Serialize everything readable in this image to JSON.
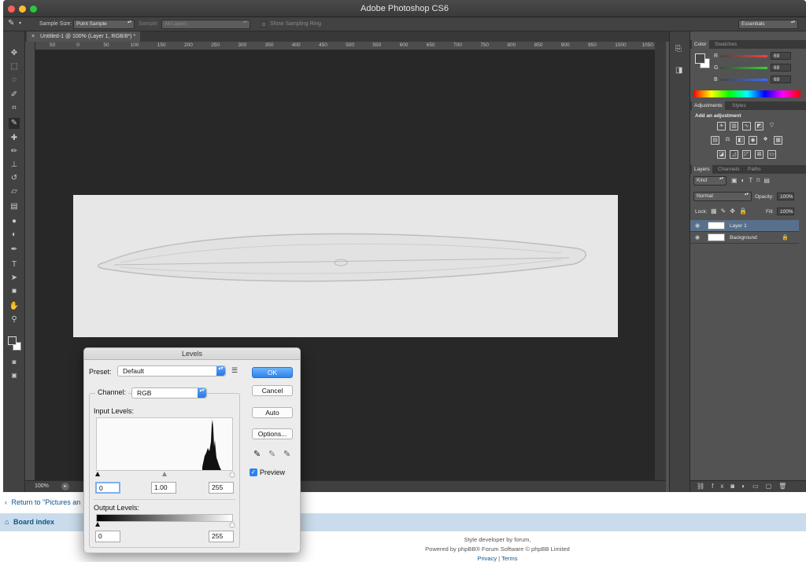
{
  "window": {
    "title": "Adobe Photoshop CS6"
  },
  "options_bar": {
    "sample_size_label": "Sample Size:",
    "sample_size_value": "Point Sample",
    "sample_label": "Sample:",
    "sample_value": "All Layers",
    "sampling_ring_label": "Show Sampling Ring",
    "workspace": "Essentials"
  },
  "document_tab": {
    "close": "×",
    "title": "Untitled-1 @ 100% (Layer 1, RGB/8*) *"
  },
  "ruler_ticks": [
    "50",
    "0",
    "50",
    "100",
    "150",
    "200",
    "250",
    "300",
    "350",
    "400",
    "450",
    "500",
    "550",
    "600",
    "650",
    "700",
    "750",
    "800",
    "850",
    "900",
    "950",
    "1000",
    "1050"
  ],
  "status": {
    "zoom": "100%"
  },
  "color_panel": {
    "tabs": [
      "Color",
      "Swatches"
    ],
    "channels": [
      {
        "label": "R",
        "value": "69",
        "gradient": "#ff3b3b"
      },
      {
        "label": "G",
        "value": "69",
        "gradient": "#37d237"
      },
      {
        "label": "B",
        "value": "69",
        "gradient": "#3a6bff"
      }
    ],
    "foreground": "#454545",
    "background": "#ffffff"
  },
  "adjustments_panel": {
    "tabs": [
      "Adjustments",
      "Styles"
    ],
    "heading": "Add an adjustment",
    "row1": [
      "sun",
      "curve",
      "bars",
      "slope",
      "triangle"
    ],
    "row2": [
      "grid",
      "scale",
      "mix",
      "camera",
      "ball",
      "table"
    ],
    "row3": [
      "box",
      "slash",
      "diag",
      "x-box",
      "square"
    ]
  },
  "layers_panel": {
    "tabs": [
      "Layers",
      "Channels",
      "Paths"
    ],
    "filter_kind": "Kind",
    "blend_mode": "Normal",
    "opacity_label": "Opacity:",
    "opacity_value": "100%",
    "lock_label": "Lock:",
    "fill_label": "Fill:",
    "fill_value": "100%",
    "layers": [
      {
        "name": "Layer 1",
        "selected": true
      },
      {
        "name": "Background",
        "selected": false,
        "locked": true
      }
    ]
  },
  "levels_dialog": {
    "title": "Levels",
    "preset_label": "Preset:",
    "preset_value": "Default",
    "channel_label": "Channel:",
    "channel_value": "RGB",
    "input_levels_label": "Input Levels:",
    "input_black": "0",
    "input_gamma": "1.00",
    "input_white": "255",
    "output_levels_label": "Output Levels:",
    "output_black": "0",
    "output_white": "255",
    "buttons": {
      "ok": "OK",
      "cancel": "Cancel",
      "auto": "Auto",
      "options": "Options..."
    },
    "preview_label": "Preview",
    "preview_checked": true
  },
  "forum_footer": {
    "return_link": "Return to \"Pictures an",
    "board_index": "Board index",
    "style_line": "Style developer by forum,",
    "powered_line": "Powered by phpBB® Forum Software © phpBB Limited",
    "privacy": "Privacy",
    "separator": "|",
    "terms": "Terms"
  }
}
